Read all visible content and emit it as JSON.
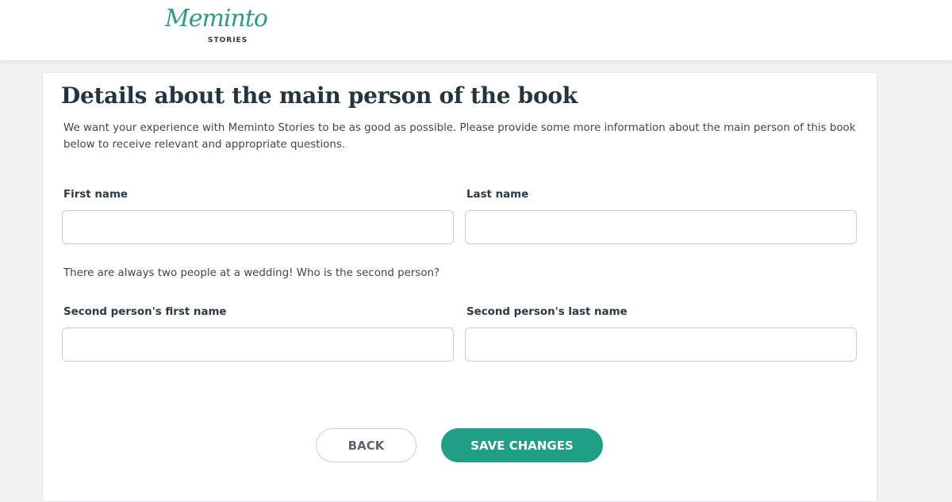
{
  "header": {
    "logo_script": "Meminto",
    "logo_sub": "STORIES"
  },
  "page": {
    "title": "Details about the main person of the book",
    "intro": "We want your experience with Meminto Stories to be as good as possible. Please provide some more information about the main person of this book below to receive relevant and appropriate questions."
  },
  "form": {
    "first_name": {
      "label": "First name",
      "value": "",
      "placeholder": ""
    },
    "last_name": {
      "label": "Last name",
      "value": "",
      "placeholder": ""
    },
    "second_note": "There are always two people at a wedding! Who is the second person?",
    "second_first_name": {
      "label": "Second person's first name",
      "value": "",
      "placeholder": ""
    },
    "second_last_name": {
      "label": "Second person's last name",
      "value": "",
      "placeholder": ""
    }
  },
  "actions": {
    "back_label": "BACK",
    "save_label": "SAVE CHANGES"
  },
  "colors": {
    "accent": "#1f9f85",
    "logo": "#2a9d8a",
    "text": "#2b3a44",
    "background": "#f2f2f3"
  }
}
